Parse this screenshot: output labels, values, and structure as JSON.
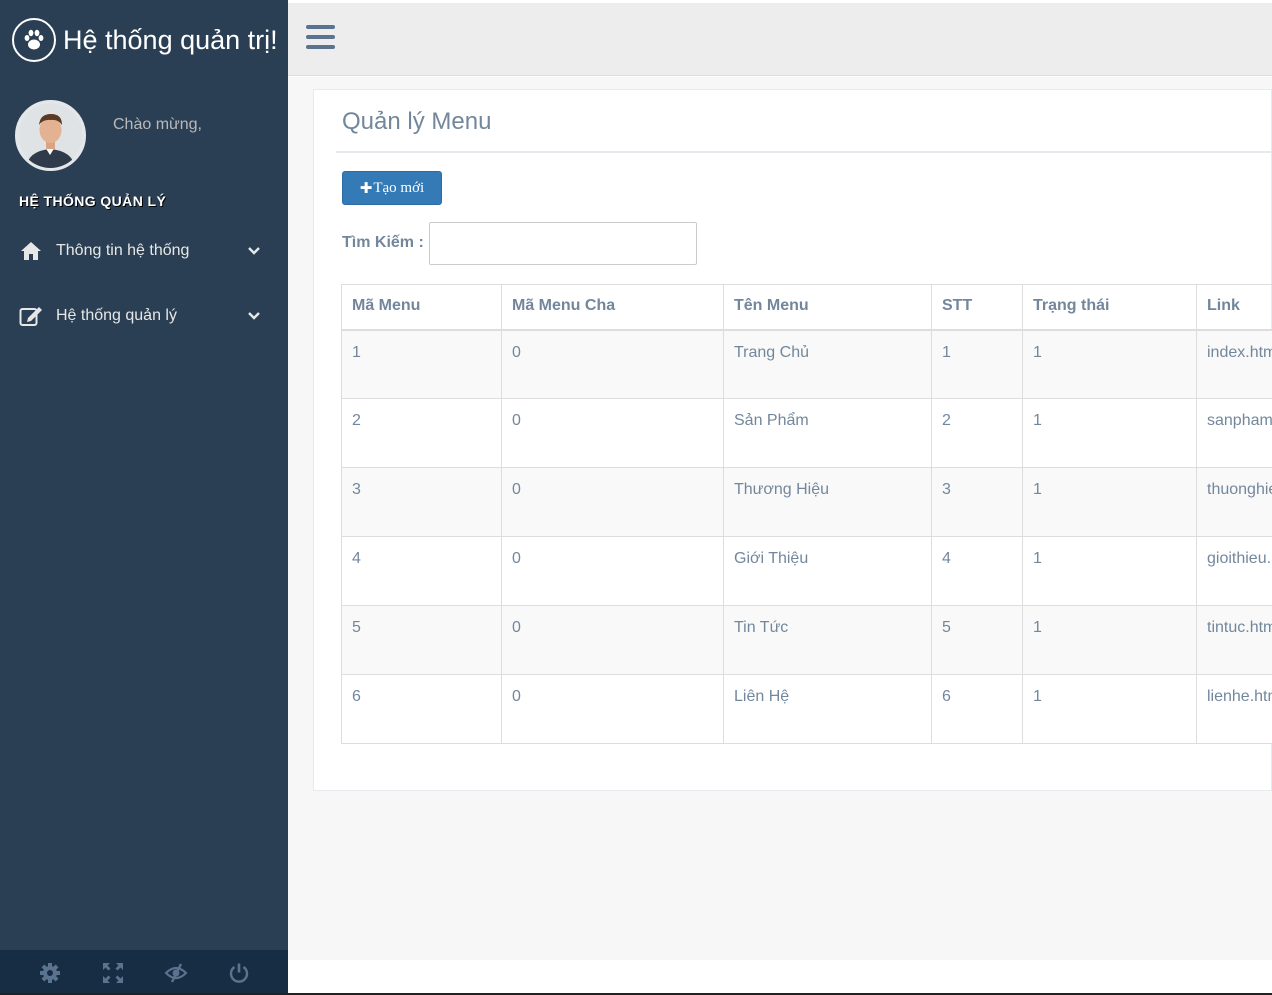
{
  "brand": {
    "title": "Hệ thống quản trị!",
    "icon": "paw-icon"
  },
  "profile": {
    "welcome": "Chào mừng,",
    "avatar": "user-avatar"
  },
  "sidebar": {
    "section_title": "HỆ THỐNG QUẢN LÝ",
    "items": [
      {
        "label": "Thông tin hệ thống",
        "icon": "home-icon"
      },
      {
        "label": "Hệ thống quản lý",
        "icon": "edit-icon"
      }
    ],
    "footer": [
      "settings-icon",
      "fullscreen-icon",
      "eye-slash-icon",
      "power-icon"
    ]
  },
  "page": {
    "title": "Quản lý Menu",
    "create_button": "Tạo mới",
    "search_label": "Tìm Kiếm :",
    "search_value": ""
  },
  "table": {
    "headers": [
      "Mã Menu",
      "Mã Menu Cha",
      "Tên Menu",
      "STT",
      "Trạng thái",
      "Link"
    ],
    "rows": [
      [
        "1",
        "0",
        "Trang Chủ",
        "1",
        "1",
        "index.htm"
      ],
      [
        "2",
        "0",
        "Sản Phẩm",
        "2",
        "1",
        "sanpham"
      ],
      [
        "3",
        "0",
        "Thương Hiệu",
        "3",
        "1",
        "thuonghie"
      ],
      [
        "4",
        "0",
        "Giới Thiệu",
        "4",
        "1",
        "gioithieu."
      ],
      [
        "5",
        "0",
        "Tin Tức",
        "5",
        "1",
        "tintuc.htm"
      ],
      [
        "6",
        "0",
        "Liên Hệ",
        "6",
        "1",
        "lienhe.htm"
      ]
    ]
  },
  "colors": {
    "sidebar": "#2a3f54",
    "sidebar_footer": "#172d44",
    "primary": "#337ab7",
    "text": "#73879c"
  }
}
